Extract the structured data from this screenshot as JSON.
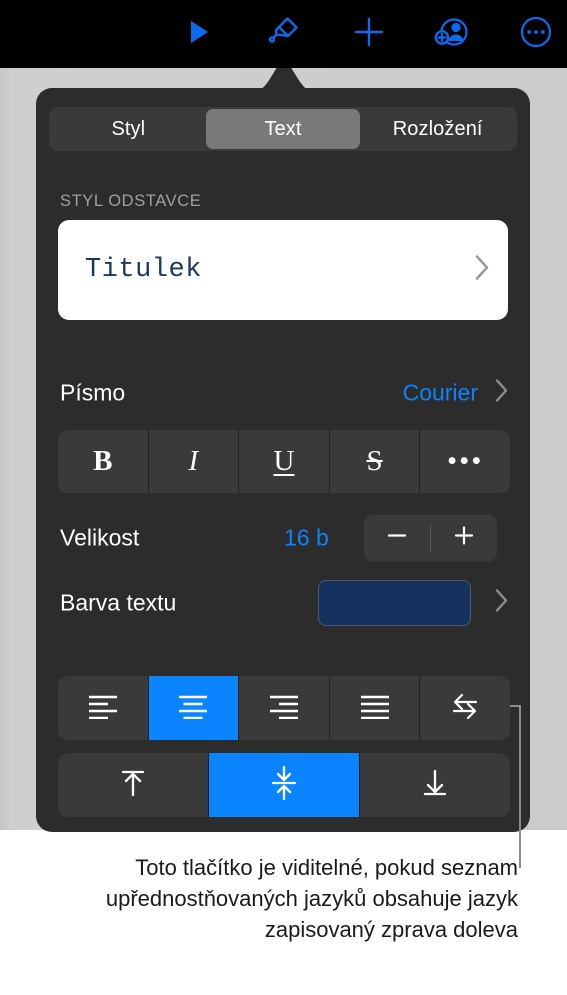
{
  "toolbar": {
    "items": [
      {
        "name": "play-icon",
        "label": "Přehrát"
      },
      {
        "name": "format-brush-icon",
        "label": "Formát"
      },
      {
        "name": "plus-icon",
        "label": "Vložit"
      },
      {
        "name": "add-person-icon",
        "label": "Spolupráce"
      },
      {
        "name": "more-circle-icon",
        "label": "Více"
      }
    ],
    "accent_color": "#0a6cf0",
    "background_color": "#000000"
  },
  "popover": {
    "tabs": [
      {
        "label": "Styl",
        "active": false
      },
      {
        "label": "Text",
        "active": true
      },
      {
        "label": "Rozložení",
        "active": false
      }
    ],
    "paragraph_style": {
      "section_label": "STYL ODSTAVCE",
      "value": "Titulek",
      "chevron": "chevron-right-icon"
    },
    "font": {
      "label": "Písmo",
      "value": "Courier",
      "chevron": "chevron-right-icon"
    },
    "style_buttons": [
      {
        "name": "bold-button",
        "glyph": "B",
        "active": false
      },
      {
        "name": "italic-button",
        "glyph": "I",
        "active": false
      },
      {
        "name": "underline-button",
        "glyph": "U",
        "active": false
      },
      {
        "name": "strikethrough-button",
        "glyph": "S",
        "active": false
      },
      {
        "name": "more-text-options-button",
        "glyph": "•••",
        "active": false
      }
    ],
    "size": {
      "label": "Velikost",
      "value": "16 b",
      "decrease_label": "−",
      "increase_label": "+"
    },
    "text_color": {
      "label": "Barva textu",
      "swatch_color": "#15325f",
      "chevron": "chevron-right-icon"
    },
    "align_buttons": [
      {
        "name": "align-left-button",
        "active": false
      },
      {
        "name": "align-center-button",
        "active": true
      },
      {
        "name": "align-right-button",
        "active": false
      },
      {
        "name": "align-justify-button",
        "active": false
      },
      {
        "name": "text-direction-rtl-button",
        "active": false
      }
    ],
    "valign_buttons": [
      {
        "name": "align-top-button",
        "active": false
      },
      {
        "name": "align-middle-button",
        "active": true
      },
      {
        "name": "align-bottom-button",
        "active": false
      }
    ],
    "selected_color": "#0a84ff",
    "background_color": "#2c2c2c"
  },
  "caption": {
    "text": "Toto tlačítko je viditelné, pokud seznam upřednostňovaných jazyků obsahuje jazyk zapisovaný zprava doleva"
  }
}
